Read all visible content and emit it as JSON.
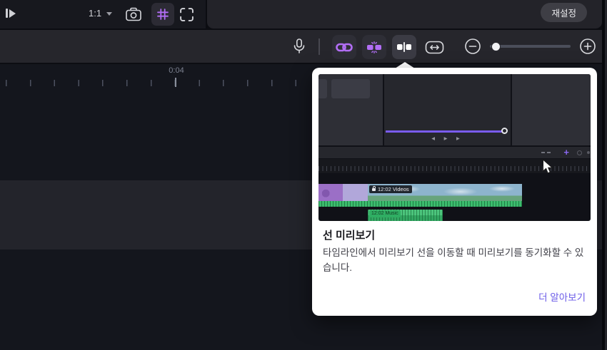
{
  "topbar": {
    "zoom_level": "1:1",
    "reset_label": "재설정"
  },
  "timeline": {
    "time_label": "0:04"
  },
  "tooltip": {
    "title": "선 미리보기",
    "body": "타임라인에서 미리보기 선을 이동할 때 미리보기를 동기화할 수 있습니다.",
    "link_label": "더 알아보기",
    "preview": {
      "video_clip_label": "12:02 Videos",
      "music_clip_label": "12:02 Music",
      "transport_glyphs": "◂ ▸ ▸",
      "plus_glyph": "+"
    }
  },
  "icons": {
    "expand-panel-icon": "bar + right triangle",
    "chevron-down-icon": "▾",
    "camera-icon": "camera outline",
    "grid-icon": "# purple grid",
    "free-transform-icon": "corner brackets",
    "mic-icon": "microphone outline",
    "link-icon": "purple chain",
    "split-blocks-icon": "purple detached blocks",
    "seek-line-icon": "block | block white",
    "fit-width-icon": "↔ in rounded rect",
    "zoom-out-icon": "⊖",
    "zoom-in-icon": "⊕",
    "cursor-icon": "mouse pointer arrow"
  },
  "colors": {
    "accent_purple": "#b26ef5",
    "link_purple": "#6b5be8",
    "seek_line_purple": "#7a5cf0",
    "waveform_green": "#3bbc6d",
    "popover_bg": "#ffffff",
    "toolbar_bg": "#26262c",
    "timeline_bg": "#14161d"
  }
}
